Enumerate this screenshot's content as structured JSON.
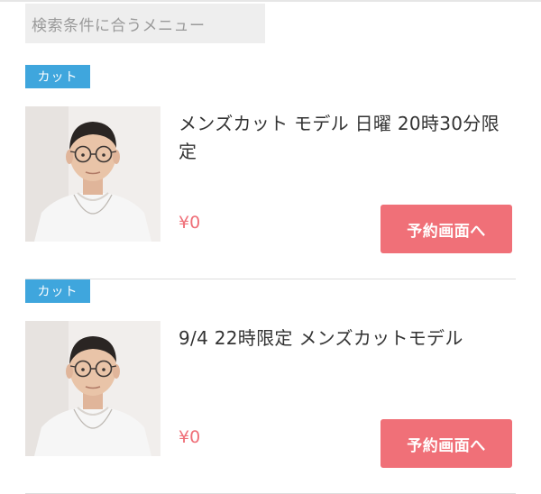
{
  "section": {
    "title": "検索条件に合うメニュー"
  },
  "menus": [
    {
      "category": "カット",
      "title": "メンズカット モデル 日曜 20時30分限定",
      "price": "¥0",
      "reserve_label": "予約画面へ"
    },
    {
      "category": "カット",
      "title": "9/4 22時限定 メンズカットモデル",
      "price": "¥0",
      "reserve_label": "予約画面へ"
    }
  ],
  "colors": {
    "badge": "#3fa6dd",
    "price": "#ef6f78",
    "button": "#f07078"
  }
}
